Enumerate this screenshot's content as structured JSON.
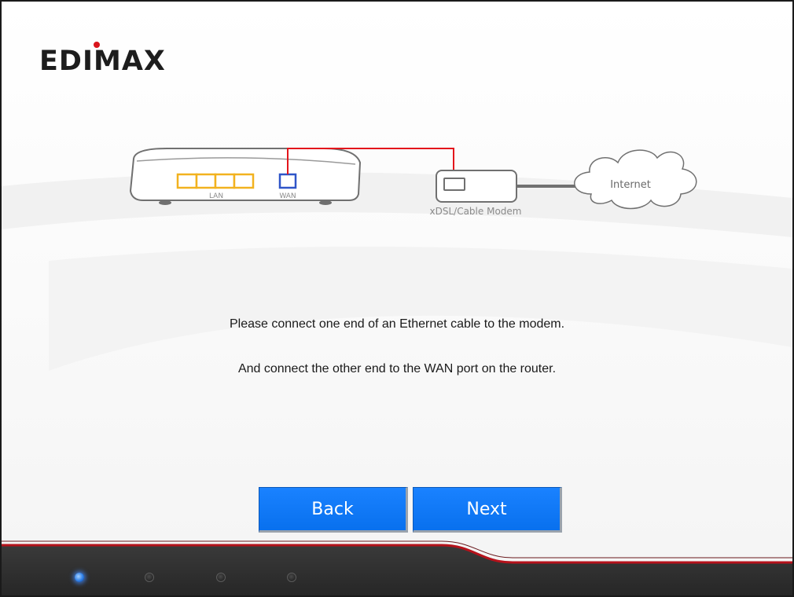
{
  "brand": {
    "logo_text": "EDIMAX"
  },
  "diagram": {
    "router_lan_label": "LAN",
    "router_wan_label": "WAN",
    "modem_label": "xDSL/Cable Modem",
    "cloud_label": "Internet",
    "colors": {
      "lan_port": "#f2b21f",
      "wan_port": "#2f55c8",
      "cable": "#e3161c",
      "outline": "#707070"
    }
  },
  "instructions": {
    "line1": "Please connect one end of an Ethernet cable to the modem.",
    "line2": "And connect the other end to the WAN port on the router."
  },
  "buttons": {
    "back": "Back",
    "next": "Next"
  },
  "steps": {
    "total": 4,
    "current": 1
  },
  "colors": {
    "button": "#0a73f0",
    "footer_accent": "#b5121b",
    "footer_bg": "#2f2f2f"
  }
}
